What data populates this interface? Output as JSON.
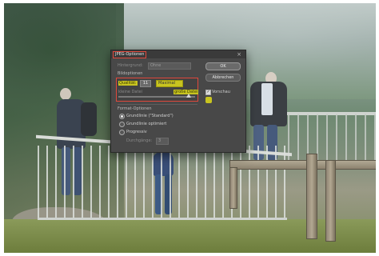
{
  "dialog": {
    "title": "JPEG-Optionen",
    "close_glyph": "×",
    "matte_label": "Hintergrund:",
    "matte_value": "Ohne",
    "ok_label": "OK",
    "cancel_label": "Abbrechen",
    "image_options": {
      "header": "Bildoptionen",
      "quality_label": "Qualität:",
      "quality_value": "11",
      "quality_preset": "Maximal",
      "small_file_label": "kleine Datei",
      "large_file_label": "große Datei"
    },
    "preview": {
      "label": "Vorschau",
      "checked": true,
      "check_glyph": "✓",
      "size_text": ""
    },
    "format_options": {
      "header": "Format-Optionen",
      "options": [
        {
          "label": "Grundlinie (\"Standard\")",
          "selected": true
        },
        {
          "label": "Grundlinie optimiert",
          "selected": false
        },
        {
          "label": "Progressiv",
          "selected": false
        }
      ],
      "scans_label": "Durchgänge:",
      "scans_value": "3"
    }
  },
  "colors": {
    "highlight_border": "#e0483c",
    "marker_yellow": "#c8c420",
    "dialog_bg": "#484848"
  }
}
